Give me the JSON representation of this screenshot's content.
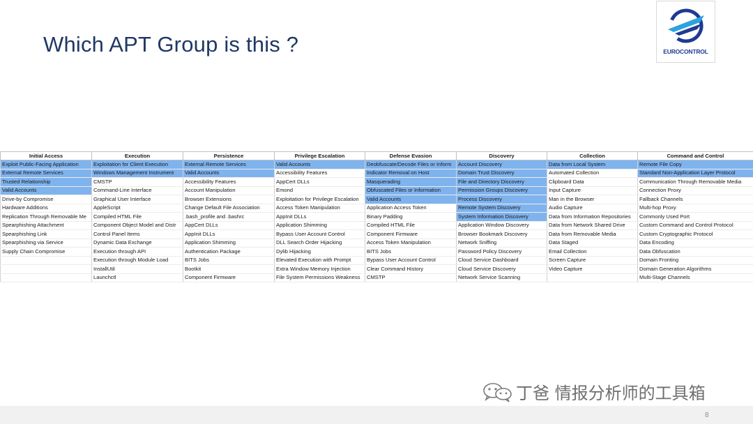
{
  "slide": {
    "title": "Which APT Group is this ?",
    "page_number": "8"
  },
  "logo": {
    "text": "EUROCONTROL",
    "colors": {
      "brand": "#1f3a93",
      "accent": "#2aa3e0"
    }
  },
  "watermark": {
    "text": "丁爸 情报分析师的工具箱",
    "icon": "wechat-icon"
  },
  "colors": {
    "highlight": "#7fb3ee",
    "title": "#1f3864"
  },
  "matrix": {
    "headers": [
      "Initial Access",
      "Execution",
      "Persistence",
      "Privilege Escalation",
      "Defense Evasion",
      "Discovery",
      "Collection",
      "Command and Control"
    ],
    "columns": [
      {
        "items": [
          "Exploit Public-Facing Application",
          "External Remote Services",
          "Trusted Relationship",
          "Valid Accounts",
          "Drive-by Compromise",
          "Hardware Additions",
          "Replication Through Removable Me",
          "Spearphishing Attachment",
          "Spearphishing Link",
          "Spearphishing via Service",
          "Supply Chain Compromise",
          "",
          "",
          ""
        ],
        "highlighted": [
          0,
          1,
          2,
          3
        ]
      },
      {
        "items": [
          "Exploitation for Client Execution",
          "Windows Management Instrument",
          "CMSTP",
          "Command-Line Interface",
          "Graphical User Interface",
          "AppleScript",
          "Compiled HTML File",
          "Component Object Model and Distr",
          "Control Panel Items",
          "Dynamic Data Exchange",
          "Execution through API",
          "Execution through Module Load",
          "InstallUtil",
          "Launchctl"
        ],
        "highlighted": [
          0,
          1
        ]
      },
      {
        "items": [
          "External Remote Services",
          "Valid Accounts",
          "Accessibility Features",
          "Account Manipulation",
          "Browser Extensions",
          "Change Default File Association",
          ".bash_profile and .bashrc",
          "AppCert DLLs",
          "AppInit DLLs",
          "Application Shimming",
          "Authentication Package",
          "BITS Jobs",
          "Bootkit",
          "Component Firmware"
        ],
        "highlighted": [
          0,
          1
        ]
      },
      {
        "items": [
          "Valid Accounts",
          "Accessibility Features",
          "AppCert DLLs",
          "Emond",
          "Exploitation for Privilege Escalation",
          "Access Token Manipulation",
          "AppInit DLLs",
          "Application Shimming",
          "Bypass User Account Control",
          "DLL Search Order Hijacking",
          "Dylib Hijacking",
          "Elevated Execution with Prompt",
          "Extra Window Memory Injection",
          "File System Permissions Weakness"
        ],
        "highlighted": [
          0
        ]
      },
      {
        "items": [
          "Deobfuscate/Decode Files or Inform",
          "Indicator Removal on Host",
          "Masquerading",
          "Obfuscated Files or Information",
          "Valid Accounts",
          "Application Access Token",
          "Binary Padding",
          "Compiled HTML File",
          "Component Firmware",
          "Access Token Manipulation",
          "BITS Jobs",
          "Bypass User Account Control",
          "Clear Command History",
          "CMSTP"
        ],
        "highlighted": [
          0,
          1,
          2,
          3,
          4
        ]
      },
      {
        "items": [
          "Account Discovery",
          "Domain Trust Discovery",
          "File and Directory Discovery",
          "Permission Groups Discovery",
          "Process Discovery",
          "Remote System Discovery",
          "System Information Discovery",
          "Application Window Discovery",
          "Browser Bookmark Discovery",
          "Network Sniffing",
          "Password Policy Discovery",
          "Cloud Service Dashboard",
          "Cloud Service Discovery",
          "Network Service Scanning"
        ],
        "highlighted": [
          0,
          1,
          2,
          3,
          4,
          5,
          6
        ]
      },
      {
        "items": [
          "Data from Local System",
          "Automated Collection",
          "Clipboard Data",
          "Input Capture",
          "Man in the Browser",
          "Audio Capture",
          "Data from Information Repositories",
          "Data from Network Shared Drive",
          "Data from Removable Media",
          "Data Staged",
          "Email Collection",
          "Screen Capture",
          "Video Capture",
          ""
        ],
        "highlighted": [
          0
        ]
      },
      {
        "items": [
          "Remote File Copy",
          "Standard Non-Application Layer Protocol",
          "Communication Through Removable Media",
          "Connection Proxy",
          "Fallback Channels",
          "Multi-hop Proxy",
          "Commonly Used Port",
          "Custom Command and Control Protocol",
          "Custom Cryptographic Protocol",
          "Data Encoding",
          "Data Obfuscation",
          "Domain Fronting",
          "Domain Generation Algorithms",
          "Multi-Stage Channels"
        ],
        "highlighted": [
          0,
          1
        ]
      }
    ]
  }
}
